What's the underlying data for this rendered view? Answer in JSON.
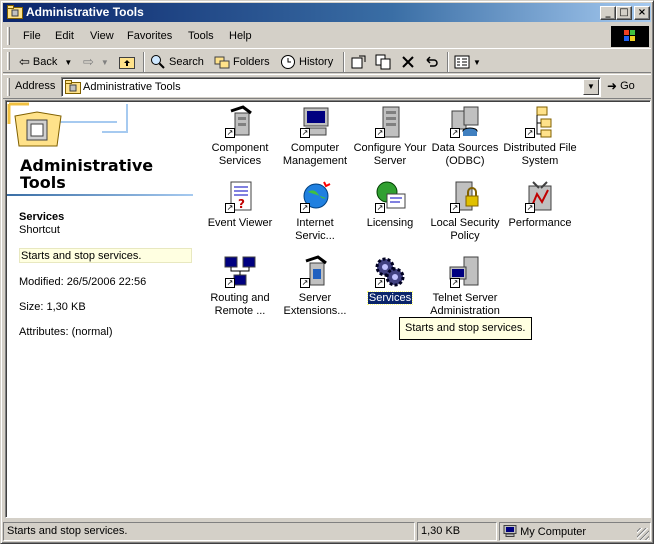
{
  "window": {
    "title": "Administrative Tools"
  },
  "menu": {
    "items": [
      "File",
      "Edit",
      "View",
      "Favorites",
      "Tools",
      "Help"
    ]
  },
  "toolbar": {
    "back": "Back",
    "search": "Search",
    "folders": "Folders",
    "history": "History"
  },
  "address": {
    "label": "Address",
    "value": "Administrative Tools",
    "go": "Go"
  },
  "webview": {
    "title": "Administrative Tools",
    "selected_name": "Services",
    "selected_type": "Shortcut",
    "description": "Starts and stop services.",
    "modified": "Modified: 26/5/2006 22:56",
    "size": "Size: 1,30 KB",
    "attributes": "Attributes: (normal)"
  },
  "icons": [
    {
      "label": "Component Services",
      "icon": "component-services-icon"
    },
    {
      "label": "Computer Management",
      "icon": "computer-management-icon"
    },
    {
      "label": "Configure Your Server",
      "icon": "configure-server-icon"
    },
    {
      "label": "Data Sources (ODBC)",
      "icon": "data-sources-icon"
    },
    {
      "label": "Distributed File System",
      "icon": "dfs-icon"
    },
    {
      "label": "Event Viewer",
      "icon": "event-viewer-icon"
    },
    {
      "label": "Internet Servic...",
      "icon": "iis-icon"
    },
    {
      "label": "Licensing",
      "icon": "licensing-icon"
    },
    {
      "label": "Local Security Policy",
      "icon": "security-policy-icon"
    },
    {
      "label": "Performance",
      "icon": "performance-icon"
    },
    {
      "label": "Routing and Remote ...",
      "icon": "routing-icon"
    },
    {
      "label": "Server Extensions...",
      "icon": "server-extensions-icon"
    },
    {
      "label": "Services",
      "icon": "services-icon",
      "selected": true
    },
    {
      "label": "Telnet Server Administration",
      "icon": "telnet-icon"
    }
  ],
  "tooltip": "Starts and stop services.",
  "status": {
    "text": "Starts and stop services.",
    "size": "1,30 KB",
    "zone": "My Computer"
  }
}
